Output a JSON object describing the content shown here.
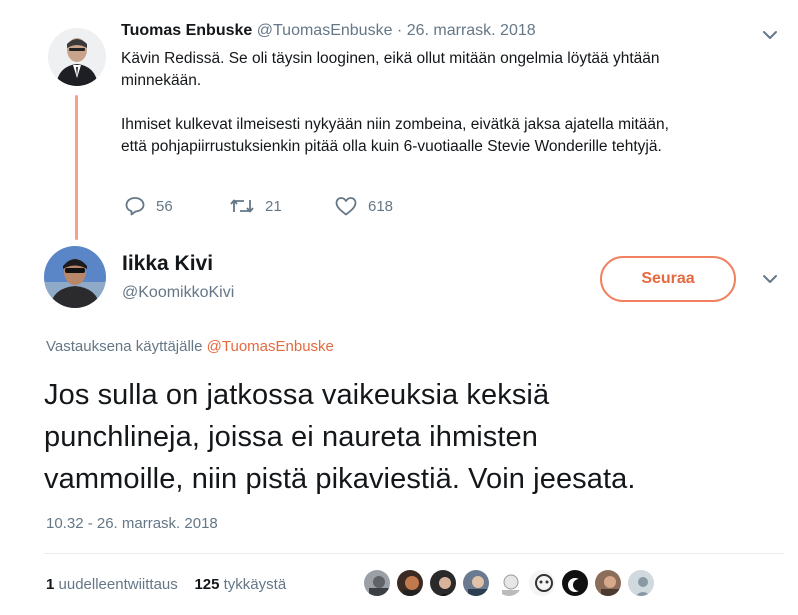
{
  "parent_tweet": {
    "display_name": "Tuomas Enbuske",
    "handle": "@TuomasEnbuske",
    "date": "· 26. marrask. 2018",
    "text_line1": "Kävin Redissä. Se oli täysin looginen, eikä ollut mitään ongelmia löytää yhtään",
    "text_line2": "minnekään.",
    "text_line3": "Ihmiset kulkevat ilmeisesti nykyään niin zombeina, eivätkä jaksa ajatella mitään,",
    "text_line4": "että pohjapiirrustuksienkin pitää olla kuin 6-vuotiaalle Stevie Wonderille tehtyjä.",
    "replies": "56",
    "retweets": "21",
    "likes": "618"
  },
  "main_tweet": {
    "display_name": "Iikka Kivi",
    "handle": "@KoomikkoKivi",
    "follow_label": "Seuraa",
    "reply_prefix": "Vastauksena käyttäjälle",
    "reply_mention": "@TuomasEnbuske",
    "text_line1": "Jos sulla on jatkossa vaikeuksia keksiä",
    "text_line2": "punchlineja, joissa ei naureta ihmisten",
    "text_line3": "vammoille, niin pistä pikaviestiä. Voin jeesata.",
    "timestamp": "10.32 - 26. marrask. 2018",
    "retweet_count": "1",
    "retweet_label": "uudelleentwiittaus",
    "like_count": "125",
    "like_label": "tykkäystä"
  },
  "colors": {
    "accent": "#e56a40",
    "thread_line": "#f5a08a",
    "muted": "#657786"
  },
  "icons": [
    "reply-icon",
    "retweet-icon",
    "heart-icon",
    "chevron-down-icon"
  ]
}
